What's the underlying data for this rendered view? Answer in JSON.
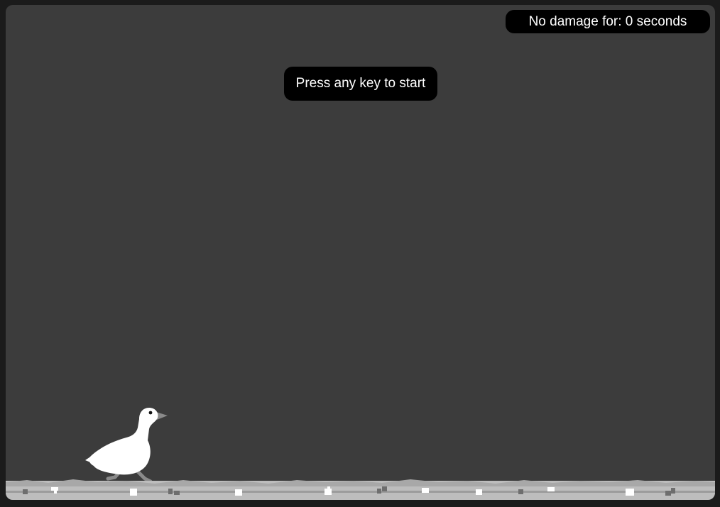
{
  "game": {
    "score_text": "No damage for: 0 seconds",
    "start_prompt": "Press any key to start"
  },
  "colors": {
    "frame": "#1b1b1b",
    "background": "#3c3c3c",
    "pill": "#000000",
    "pill_text": "#ffffff",
    "goose_body": "#ffffff",
    "goose_beak_legs": "#8a8a8a",
    "ground_light": "#bdbdbd",
    "ground_dark": "#6e6e6e"
  },
  "icons": {
    "player": "goose-icon"
  }
}
